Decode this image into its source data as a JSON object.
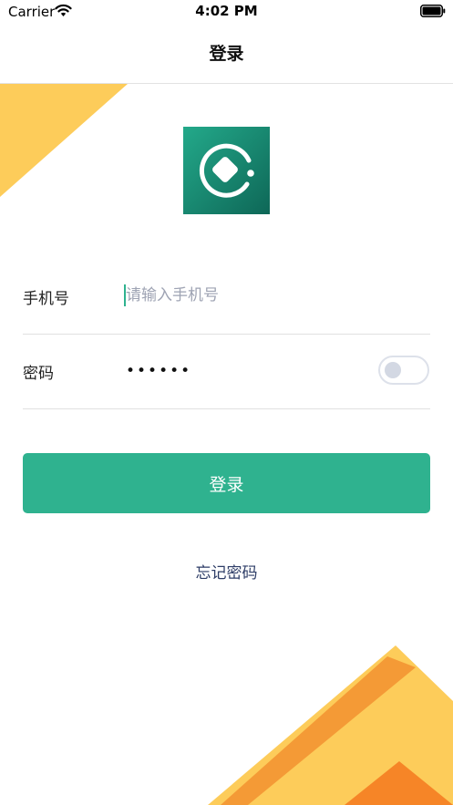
{
  "status_bar": {
    "carrier": "Carrier",
    "time": "4:02 PM"
  },
  "nav": {
    "title": "登录"
  },
  "form": {
    "phone_label": "手机号",
    "phone_placeholder": "请输入手机号",
    "phone_value": "",
    "password_label": "密码",
    "password_value": "••••••",
    "show_password": false
  },
  "actions": {
    "login_label": "登录",
    "forgot_password_label": "忘记密码"
  },
  "colors": {
    "accent": "#2fb28f",
    "link": "#2d3c66",
    "deco_yellow": "#fdcc5a",
    "deco_orange": "#f49a36",
    "deco_dark_orange": "#f68527"
  }
}
